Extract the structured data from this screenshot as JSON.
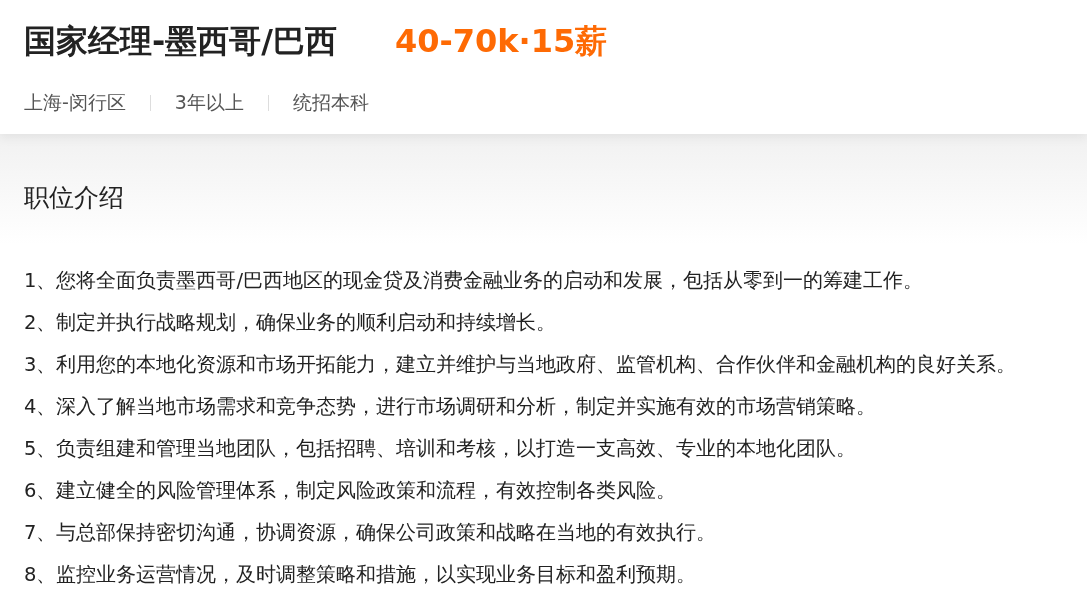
{
  "job": {
    "title": "国家经理-墨西哥/巴西",
    "salary": "40-70k·15薪",
    "tags": [
      "上海-闵行区",
      "3年以上",
      "统招本科"
    ]
  },
  "description": {
    "heading": "职位介绍",
    "items": [
      "1、您将全面负责墨西哥/巴西地区的现金贷及消费金融业务的启动和发展，包括从零到一的筹建工作。",
      "2、制定并执行战略规划，确保业务的顺利启动和持续增长。",
      "3、利用您的本地化资源和市场开拓能力，建立并维护与当地政府、监管机构、合作伙伴和金融机构的良好关系。",
      "4、深入了解当地市场需求和竞争态势，进行市场调研和分析，制定并实施有效的市场营销策略。",
      "5、负责组建和管理当地团队，包括招聘、培训和考核，以打造一支高效、专业的本地化团队。",
      "6、建立健全的风险管理体系，制定风险政策和流程，有效控制各类风险。",
      "7、与总部保持密切沟通，协调资源，确保公司政策和战略在当地的有效执行。",
      "8、监控业务运营情况，及时调整策略和措施，以实现业务目标和盈利预期。"
    ]
  }
}
